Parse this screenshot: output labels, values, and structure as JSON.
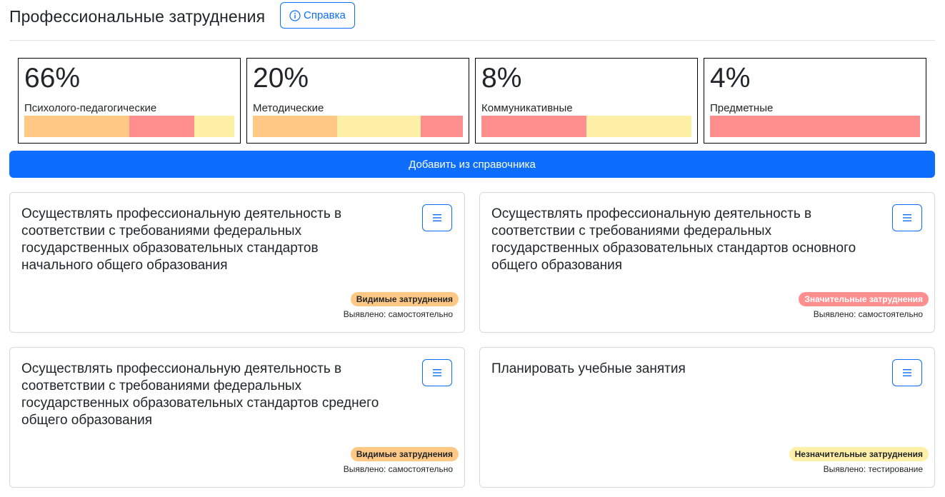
{
  "header": {
    "title": "Профессиональные затруднения",
    "help_label": "Справка"
  },
  "colors": {
    "orange": "#ffc985",
    "red": "#ff8f8f",
    "yellow": "#fff0a8",
    "primary": "#0d6efd"
  },
  "stats": [
    {
      "value": "66%",
      "label": "Психолого-педагогические",
      "segments": [
        {
          "color": "orange",
          "fraction": 0.5
        },
        {
          "color": "red",
          "fraction": 0.31
        },
        {
          "color": "yellow",
          "fraction": 0.19
        }
      ]
    },
    {
      "value": "20%",
      "label": "Методические",
      "segments": [
        {
          "color": "orange",
          "fraction": 0.4
        },
        {
          "color": "yellow",
          "fraction": 0.4
        },
        {
          "color": "red",
          "fraction": 0.2
        }
      ]
    },
    {
      "value": "8%",
      "label": "Коммуникативные",
      "segments": [
        {
          "color": "red",
          "fraction": 0.5
        },
        {
          "color": "yellow",
          "fraction": 0.5
        }
      ]
    },
    {
      "value": "4%",
      "label": "Предметные",
      "segments": [
        {
          "color": "red",
          "fraction": 1.0
        }
      ]
    }
  ],
  "add_button_label": "Добавить из справочника",
  "cards": [
    {
      "title": "Осуществлять профессиональную деятельность в соответствии с требованиями федеральных государственных образовательных стандартов начального общего образования",
      "badge": "Видимые затруднения",
      "badge_type": "visible",
      "identified": "Выявлено: самостоятельно"
    },
    {
      "title": "Осуществлять профессиональную деятельность в соответствии с требованиями федеральных государственных образовательных стандартов основного общего образования",
      "badge": "Значительные затруднения",
      "badge_type": "significant",
      "identified": "Выявлено: самостоятельно"
    },
    {
      "title": "Осуществлять профессиональную деятельность в соответствии с требованиями федеральных государственных образовательных стандартов среднего общего образования",
      "badge": "Видимые затруднения",
      "badge_type": "visible",
      "identified": "Выявлено: самостоятельно"
    },
    {
      "title": "Планировать учебные занятия",
      "badge": "Незначительные затруднения",
      "badge_type": "minor",
      "identified": "Выявлено: тестирование"
    }
  ]
}
